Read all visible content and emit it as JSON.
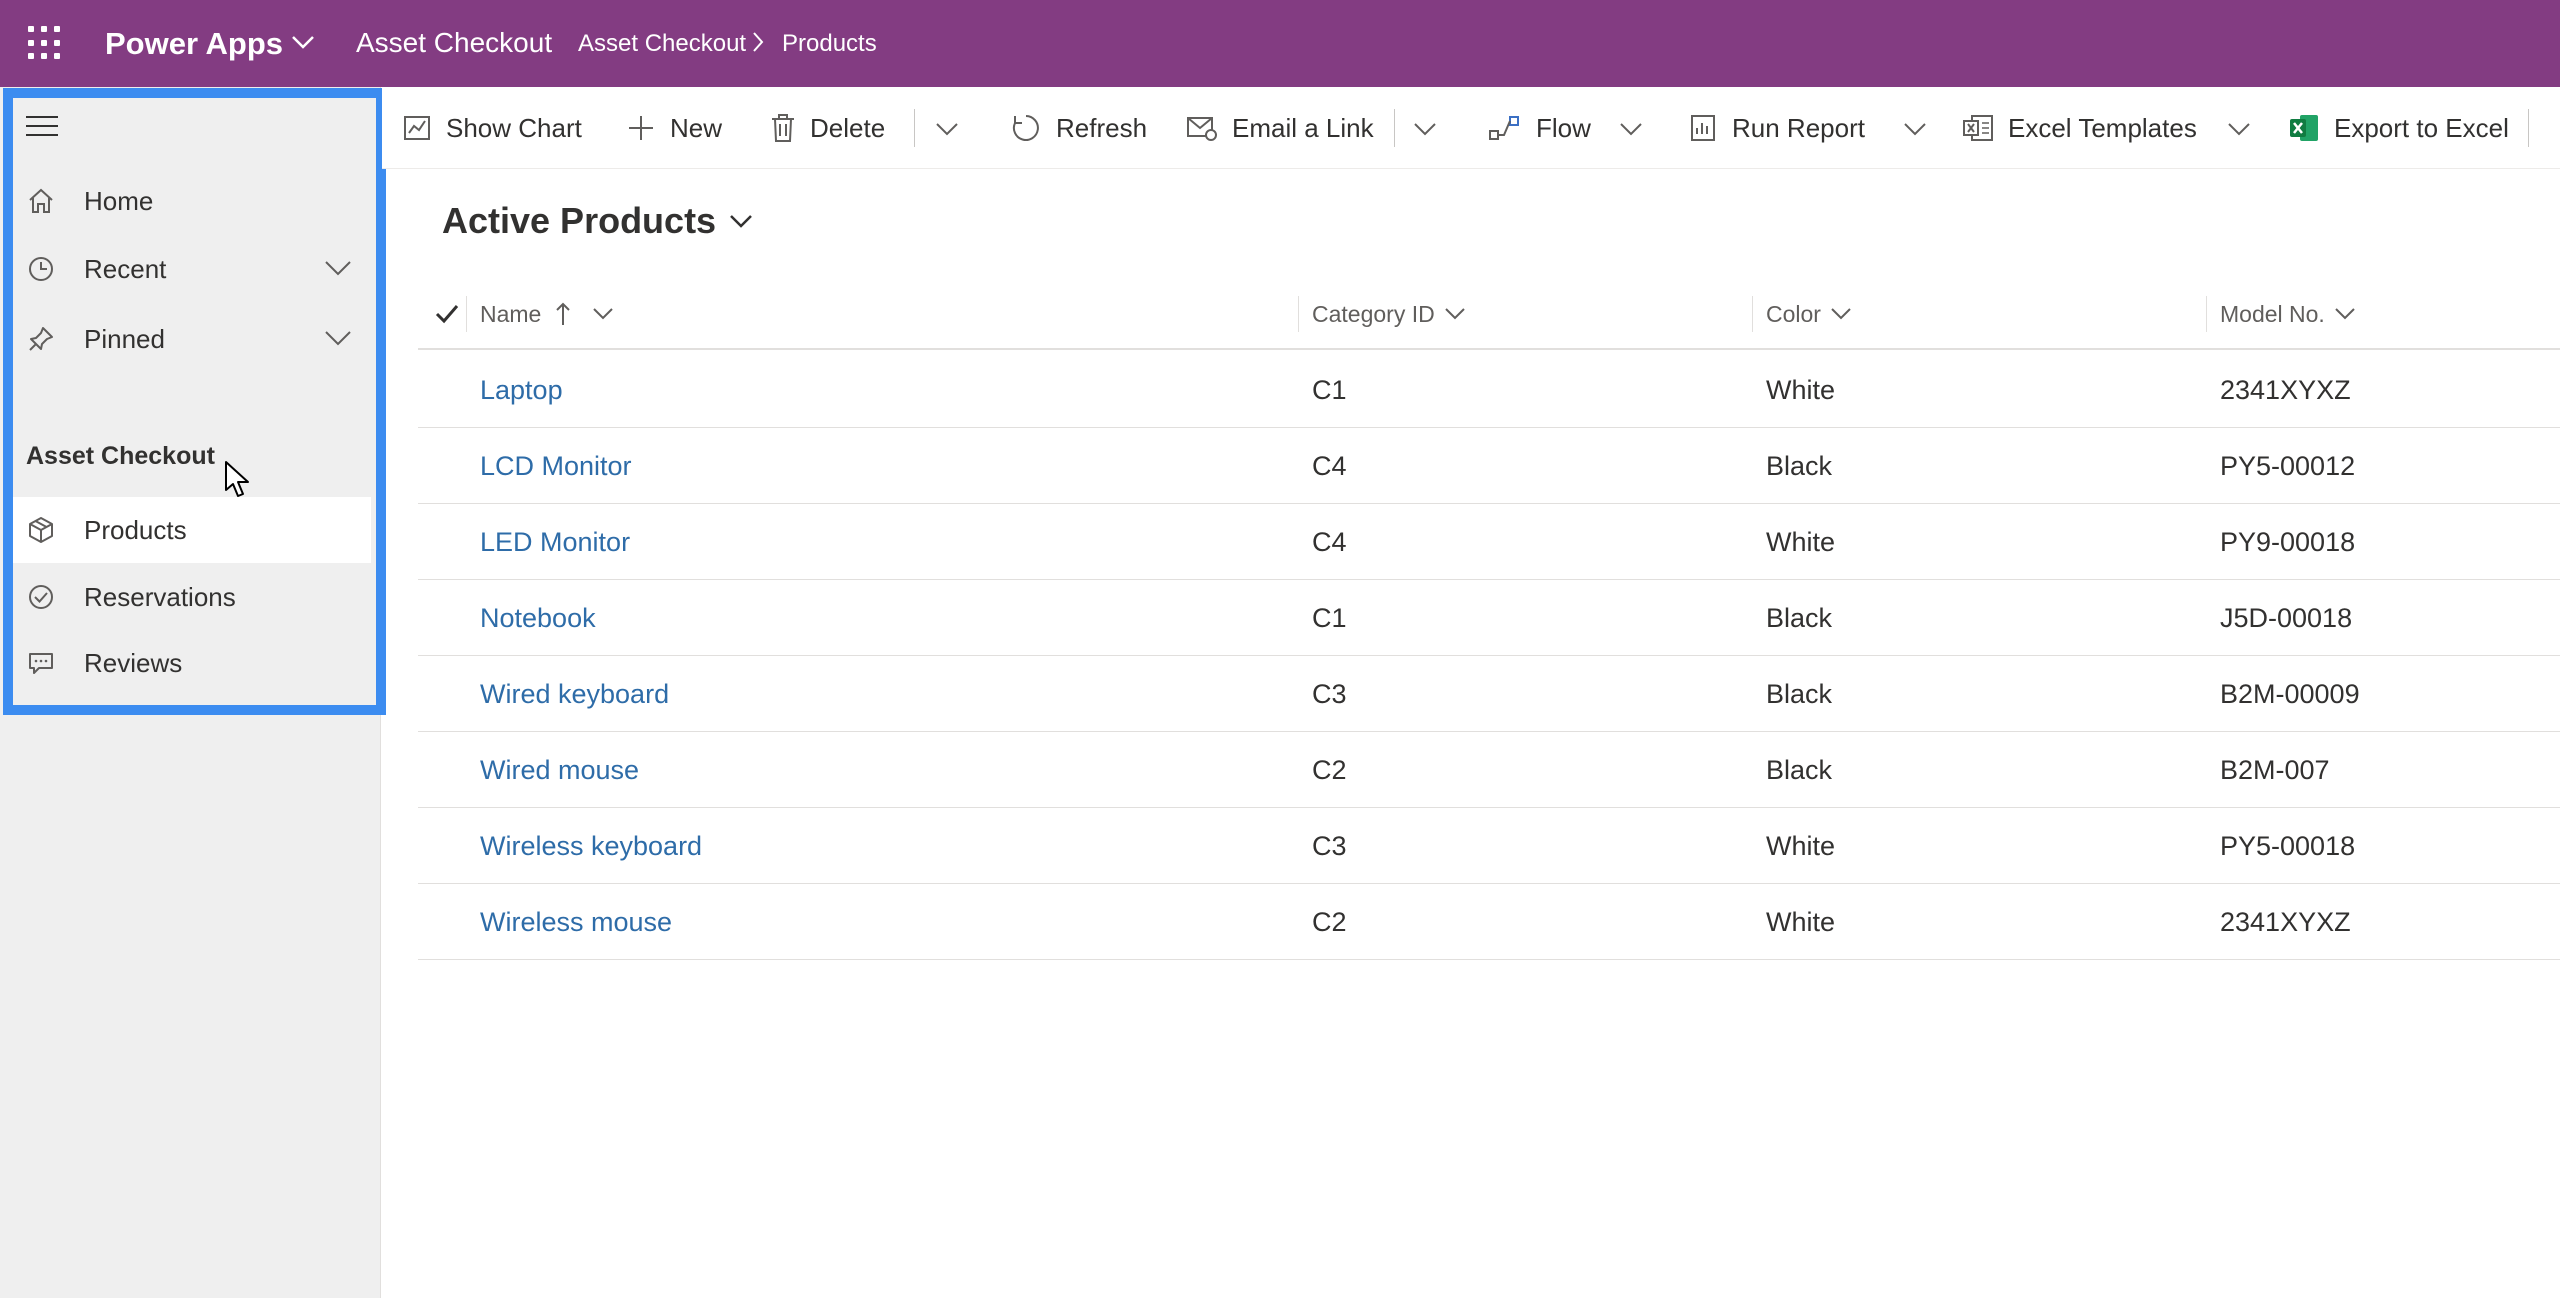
{
  "topbar": {
    "app_name": "Power Apps",
    "app_title": "Asset Checkout",
    "breadcrumb": [
      "Asset Checkout",
      "Products"
    ],
    "bg_color": "#833c82"
  },
  "sidebar": {
    "items": [
      {
        "label": "Home",
        "icon": "home-icon"
      },
      {
        "label": "Recent",
        "icon": "clock-icon"
      },
      {
        "label": "Pinned",
        "icon": "pin-icon"
      }
    ],
    "section_label": "Asset Checkout",
    "section_items": [
      {
        "label": "Products",
        "icon": "cube-icon",
        "active": true
      },
      {
        "label": "Reservations",
        "icon": "check-circle-icon"
      },
      {
        "label": "Reviews",
        "icon": "comment-icon"
      }
    ],
    "highlight_color": "#3c8cf0"
  },
  "commandbar": {
    "show_chart": "Show Chart",
    "new": "New",
    "delete": "Delete",
    "refresh": "Refresh",
    "email_link": "Email a Link",
    "flow": "Flow",
    "run_report": "Run Report",
    "excel_templates": "Excel Templates",
    "export_excel": "Export to Excel"
  },
  "view": {
    "title": "Active Products"
  },
  "grid": {
    "columns": [
      "Name",
      "Category ID",
      "Color",
      "Model No."
    ],
    "rows": [
      {
        "name": "Laptop",
        "category": "C1",
        "color": "White",
        "model": "2341XYXZ"
      },
      {
        "name": "LCD Monitor",
        "category": "C4",
        "color": "Black",
        "model": "PY5-00012"
      },
      {
        "name": "LED Monitor",
        "category": "C4",
        "color": "White",
        "model": "PY9-00018"
      },
      {
        "name": "Notebook",
        "category": "C1",
        "color": "Black",
        "model": "J5D-00018"
      },
      {
        "name": "Wired keyboard",
        "category": "C3",
        "color": "Black",
        "model": "B2M-00009"
      },
      {
        "name": "Wired mouse",
        "category": "C2",
        "color": "Black",
        "model": "B2M-007"
      },
      {
        "name": "Wireless keyboard",
        "category": "C3",
        "color": "White",
        "model": "PY5-00018"
      },
      {
        "name": "Wireless mouse",
        "category": "C2",
        "color": "White",
        "model": "2341XYXZ"
      }
    ]
  }
}
